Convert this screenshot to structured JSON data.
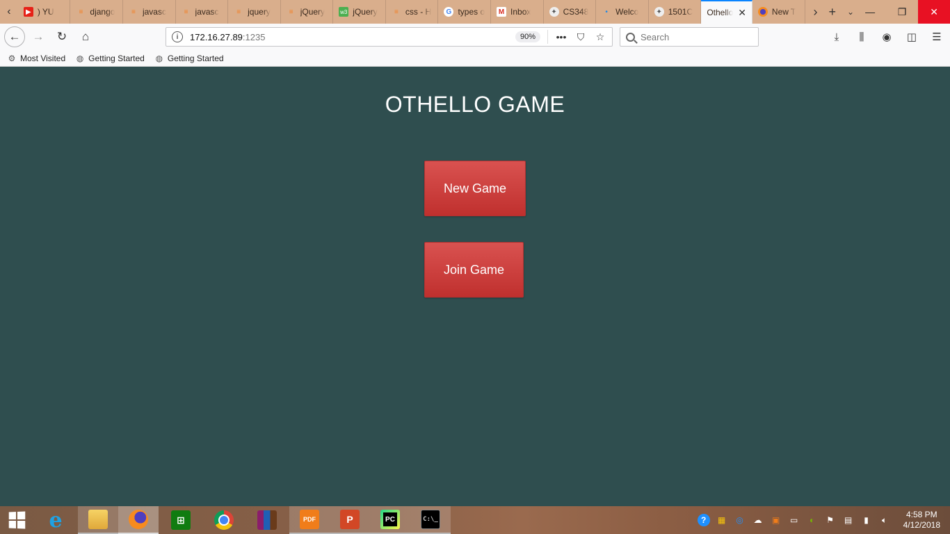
{
  "browser": {
    "tabs": [
      {
        "label": ") YU",
        "icon": "youtube-icon"
      },
      {
        "label": "django",
        "icon": "stackoverflow-icon"
      },
      {
        "label": "javasc",
        "icon": "stackoverflow-icon"
      },
      {
        "label": "javasc",
        "icon": "stackoverflow-icon"
      },
      {
        "label": "jquery",
        "icon": "stackoverflow-icon"
      },
      {
        "label": "jQuery",
        "icon": "stackoverflow-icon"
      },
      {
        "label": "jQuery",
        "icon": "w3schools-icon"
      },
      {
        "label": "css - H",
        "icon": "stackoverflow-icon"
      },
      {
        "label": "types o",
        "icon": "google-icon"
      },
      {
        "label": "Inbox",
        "icon": "gmail-icon"
      },
      {
        "label": "CS348",
        "icon": "course-icon"
      },
      {
        "label": "Welco",
        "icon": "dot-icon"
      },
      {
        "label": "1501C",
        "icon": "course-icon"
      },
      {
        "label": "Othello",
        "icon": "none",
        "active": true
      },
      {
        "label": "New T",
        "icon": "firefox-icon"
      }
    ],
    "url_host": "172.16.27.89",
    "url_port": ":1235",
    "zoom": "90%",
    "search_placeholder": "Search",
    "bookmarks": [
      {
        "label": "Most Visited",
        "icon": "gear-icon"
      },
      {
        "label": "Getting Started",
        "icon": "globe-icon"
      },
      {
        "label": "Getting Started",
        "icon": "globe-icon"
      }
    ]
  },
  "page": {
    "title": "OTHELLO GAME",
    "new_game": "New Game",
    "join_game": "Join Game"
  },
  "taskbar": {
    "time": "4:58 PM",
    "date": "4/12/2018"
  },
  "colors": {
    "page_bg": "#2f4e4f",
    "button_red": "#c9403e",
    "tab_strip": "#d9ae8c",
    "active_tab_accent": "#0a84ff"
  }
}
